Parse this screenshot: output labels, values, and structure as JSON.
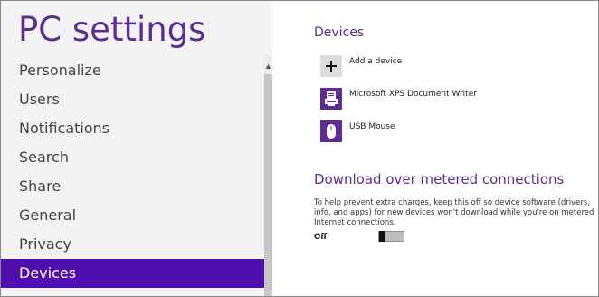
{
  "left": {
    "title": "PC settings",
    "nav_items": [
      {
        "label": "Personalize"
      },
      {
        "label": "Users"
      },
      {
        "label": "Notifications"
      },
      {
        "label": "Search"
      },
      {
        "label": "Share"
      },
      {
        "label": "General"
      },
      {
        "label": "Privacy"
      },
      {
        "label": "Devices"
      }
    ],
    "selected_item": "Devices"
  },
  "devices": {
    "heading": "Devices",
    "items": [
      {
        "label": "Add a device",
        "icon": "plus-icon"
      },
      {
        "label": "Microsoft XPS Document Writer",
        "icon": "printer-document-icon"
      },
      {
        "label": "USB Mouse",
        "icon": "mouse-icon"
      }
    ]
  },
  "metered": {
    "heading": "Download over metered connections",
    "description": "To help prevent extra charges, keep this off so device software (drivers, info, and apps) for new devices won't download while you're on metered Internet connections.",
    "toggle_label": "Off",
    "toggle_on": false
  },
  "colors": {
    "accent": "#5b2d91",
    "selected_bg": "#4f0ead",
    "tile_bg": "#5f2a91"
  }
}
